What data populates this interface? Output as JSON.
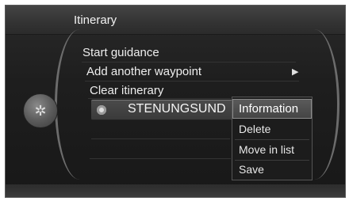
{
  "header": {
    "title": "Itinerary"
  },
  "menu": {
    "items": [
      {
        "label": "Start guidance"
      },
      {
        "label": "Add another waypoint",
        "has_submenu": true
      },
      {
        "label": "Clear itinerary"
      }
    ],
    "selected_destination": "STENUNGSUND"
  },
  "popup": {
    "items": [
      {
        "label": "Information",
        "selected": true
      },
      {
        "label": "Delete"
      },
      {
        "label": "Move in list"
      },
      {
        "label": "Save"
      }
    ]
  },
  "icons": {
    "knob": "compass-star-icon",
    "submenu": "triangle-right-icon",
    "destination": "radio-dot-icon"
  },
  "colors": {
    "background": "#1e1e1e",
    "text": "#eeeeee",
    "highlight": "#5a5a5a"
  }
}
